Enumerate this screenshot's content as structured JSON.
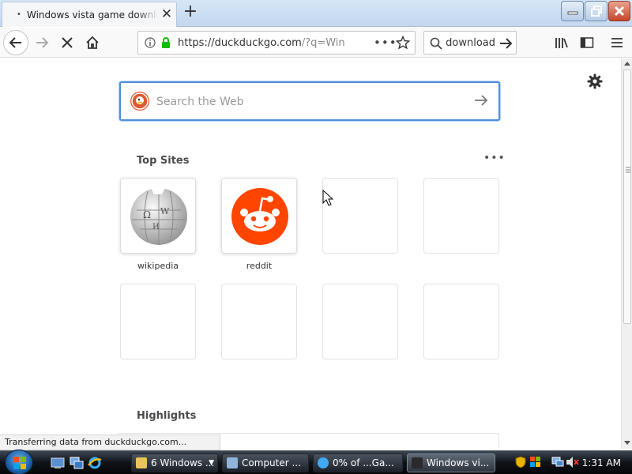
{
  "tab": {
    "title": "Windows vista game download"
  },
  "navbar": {
    "url_host": "https://duckduckgo.com",
    "url_path": "/?q=Windows",
    "search_value": "download"
  },
  "content": {
    "search_placeholder": "Search the Web",
    "top_sites_title": "Top Sites",
    "more_label": "•••",
    "highlights_title": "Highlights",
    "tiles": [
      {
        "label": "wikipedia",
        "icon": "wikipedia-globe"
      },
      {
        "label": "reddit",
        "icon": "reddit-alien"
      }
    ]
  },
  "status": "Transferring data from duckduckgo.com...",
  "taskbar": {
    "buttons": [
      {
        "label": "6 Windows ..."
      },
      {
        "label": "Computer ..."
      },
      {
        "label": "0% of ...Ga..."
      },
      {
        "label": "Windows vi..."
      }
    ],
    "clock": "1:31 AM"
  },
  "colors": {
    "accent": "#4f8fd8",
    "reddit": "#ff4500",
    "ddg": "#de5833"
  }
}
